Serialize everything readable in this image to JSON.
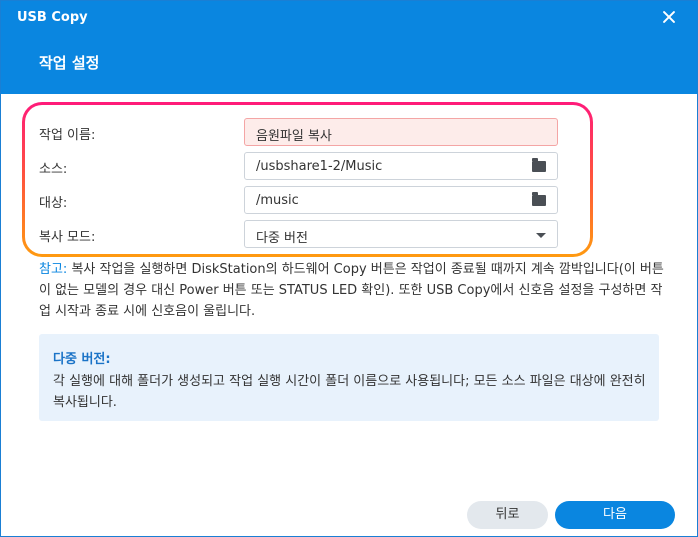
{
  "window": {
    "title": "USB Copy"
  },
  "header": {
    "step_title": "작업 설정"
  },
  "form": {
    "task_name": {
      "label": "작업 이름:",
      "value": "음원파일 복사"
    },
    "source": {
      "label": "소스:",
      "value": "/usbshare1-2/Music"
    },
    "destination": {
      "label": "대상:",
      "value": "/music"
    },
    "copy_mode": {
      "label": "복사 모드:",
      "value": "다중 버전"
    }
  },
  "note": {
    "prefix": "참고:",
    "text": " 복사 작업을 실행하면 DiskStation의 하드웨어 Copy 버튼은 작업이 종료될 때까지 계속 깜박입니다(이 버튼이 없는 모델의 경우 대신 Power 버튼 또는 STATUS LED 확인). 또한 USB Copy에서 신호음 설정을 구성하면 작업 시작과 종료 시에 신호음이 울립니다."
  },
  "info": {
    "title": "다중 버전:",
    "text": "각 실행에 대해 폴더가 생성되고 작업 실행 시간이 폴더 이름으로 사용됩니다; 모든 소스 파일은 대상에 완전히 복사됩니다."
  },
  "footer": {
    "back_label": "뒤로",
    "next_label": "다음"
  },
  "colors": {
    "accent": "#0a86e0",
    "highlight_top": "#ff1a7a",
    "highlight_bottom": "#ff9a10",
    "error_bg": "#fdecea"
  }
}
